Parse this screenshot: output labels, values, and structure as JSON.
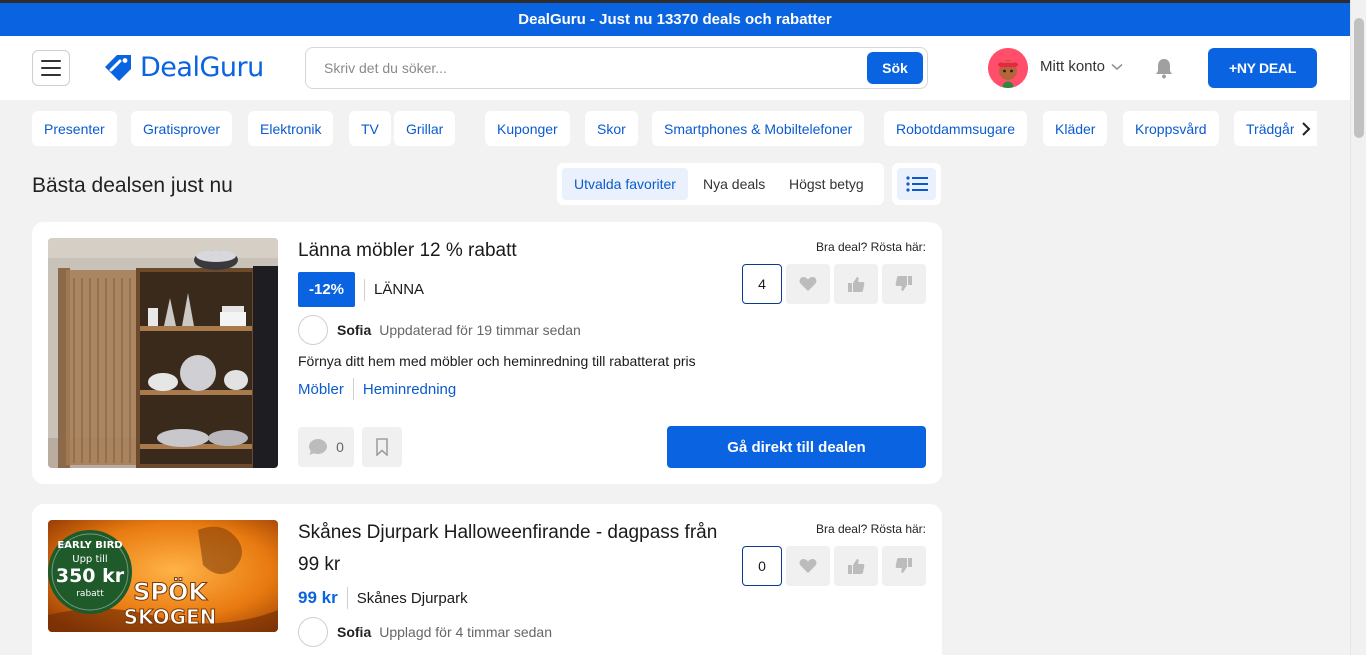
{
  "banner": {
    "text": "DealGuru - Just nu 13370 deals och rabatter"
  },
  "header": {
    "logo_text": "DealGuru",
    "search_placeholder": "Skriv det du söker...",
    "search_button": "Sök",
    "account_label": "Mitt konto",
    "new_deal_button": "+NY DEAL"
  },
  "categories": [
    "Presenter",
    "Gratisprover",
    "Elektronik",
    "TV",
    "Grillar",
    "Kuponger",
    "Skor",
    "Smartphones & Mobiltelefoner",
    "Robotdammsugare",
    "Kläder",
    "Kroppsvård",
    "Trädgård"
  ],
  "main": {
    "title": "Bästa dealsen just nu",
    "sort_options": [
      "Utvalda favoriter",
      "Nya deals",
      "Högst betyg"
    ],
    "active_sort": "Utvalda favoriter"
  },
  "deals": [
    {
      "title": "Länna möbler 12 % rabatt",
      "discount": "-12%",
      "store": "LÄNNA",
      "author": "Sofia",
      "updated": "Uppdaterad för 19 timmar sedan",
      "description": "Förnya ditt hem med möbler och heminredning till rabatterat pris",
      "tags": [
        "Möbler",
        "Heminredning"
      ],
      "vote_label": "Bra deal? Rösta här:",
      "votes": "4",
      "comments": "0",
      "cta": "Gå direkt till dealen"
    },
    {
      "title_line1": "Skånes Djurpark Halloweenfirande - dagpass från",
      "title_line2": "99 kr",
      "price": "99 kr",
      "store": "Skånes Djurpark",
      "author": "Sofia",
      "updated": "Upplagd för 4 timmar sedan",
      "vote_label": "Bra deal? Rösta här:",
      "votes": "0",
      "image_text": {
        "early": "EARLY BIRD",
        "upto": "Upp till",
        "amount": "350 kr",
        "rabatt": "rabatt",
        "spok": "SPÖK",
        "skogen": "SKOGEN"
      }
    }
  ],
  "colors": {
    "brand": "#0a63e0",
    "background": "#f2f2f2"
  }
}
